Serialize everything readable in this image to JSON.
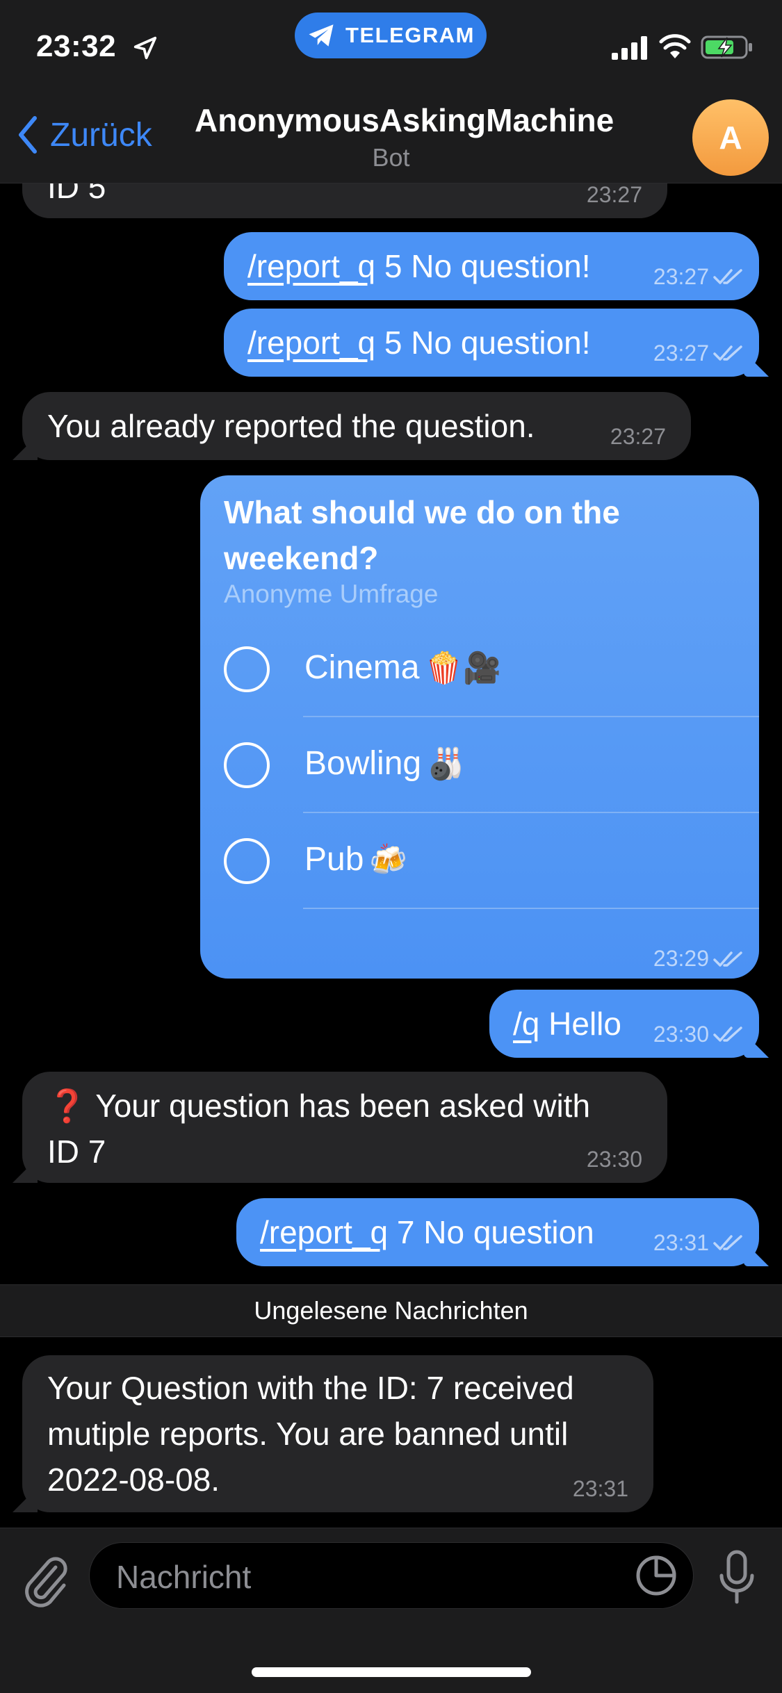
{
  "status_bar": {
    "time": "23:32",
    "app_pill": "TELEGRAM"
  },
  "header": {
    "back_label": "Zurück",
    "title": "AnonymousAskingMachine",
    "subtitle": "Bot",
    "avatar_letter": "A"
  },
  "messages": {
    "m0": {
      "text": "ID 5",
      "time": "23:27"
    },
    "m1": {
      "cmd": "/report_q",
      "text": " 5 No question!",
      "time": "23:27"
    },
    "m2": {
      "cmd": "/report_q",
      "text": " 5 No question!",
      "time": "23:27"
    },
    "m3": {
      "text": "You already reported the question.",
      "time": "23:27"
    },
    "poll": {
      "question": "What should we do on the weekend?",
      "type": "Anonyme Umfrage",
      "options": [
        {
          "label": "Cinema",
          "emoji": "🍿🎥"
        },
        {
          "label": "Bowling",
          "emoji": "🎳"
        },
        {
          "label": "Pub",
          "emoji": "🍻"
        }
      ],
      "time": "23:29"
    },
    "m5": {
      "cmd": "/q",
      "text": " Hello",
      "time": "23:30"
    },
    "m6": {
      "emoji": "❓",
      "text_line1": " Your question has been asked with",
      "text_line2": "ID 7",
      "time": "23:30"
    },
    "m7": {
      "cmd": "/report_q",
      "text": " 7 No question",
      "time": "23:31"
    },
    "unread_label": "Ungelesene Nachrichten",
    "m8": {
      "line1": "Your Question with the ID: 7 received",
      "line2": "mutiple reports. You are banned until",
      "line3": "2022-08-08.",
      "time": "23:31"
    }
  },
  "input": {
    "placeholder": "Nachricht"
  },
  "colors": {
    "outgoing": "#4c93f5",
    "incoming": "#262628",
    "accent": "#3e88f7",
    "background": "#000000"
  },
  "icons": [
    "location-arrow-icon",
    "telegram-plane-icon",
    "signal-icon",
    "wifi-icon",
    "battery-charging-icon",
    "chevron-left-icon",
    "double-check-icon",
    "paperclip-icon",
    "sticker-icon",
    "microphone-icon"
  ]
}
